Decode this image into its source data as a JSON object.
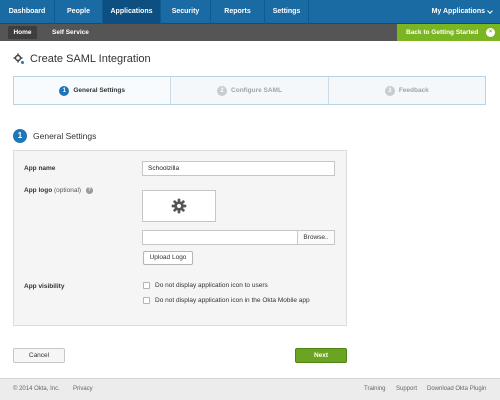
{
  "topnav": {
    "tabs": [
      "Dashboard",
      "People",
      "Applications",
      "Security",
      "Reports",
      "Settings"
    ],
    "active_tab": "Applications",
    "my_apps": "My Applications"
  },
  "subnav": {
    "home": "Home",
    "self_service": "Self Service",
    "get_started": "Back to Getting Started",
    "close": "×"
  },
  "page": {
    "title": "Create SAML Integration",
    "icon": "gear-icon"
  },
  "wizard": {
    "steps": [
      {
        "num": "1",
        "label": "General Settings"
      },
      {
        "num": "2",
        "label": "Configure SAML"
      },
      {
        "num": "3",
        "label": "Feedback"
      }
    ]
  },
  "section": {
    "num": "1",
    "title": "General Settings"
  },
  "form": {
    "app_name_label": "App name",
    "app_name_value": "Schoolzilla",
    "app_logo_label": "App logo",
    "app_logo_optional": "(optional)",
    "help": "?",
    "browse": "Browse..",
    "upload": "Upload Logo",
    "visibility_label": "App visibility",
    "visibility_options": [
      "Do not display application icon to users",
      "Do not display application icon in the Okta Mobile app"
    ]
  },
  "buttons": {
    "cancel": "Cancel",
    "next": "Next"
  },
  "footer": {
    "copyright": "© 2014 Okta, Inc.",
    "privacy": "Privacy",
    "training": "Training",
    "support": "Support",
    "download": "Download Okta Plugin"
  },
  "colors": {
    "nav_blue": "#1a6aa3",
    "accent_green": "#7cb522",
    "step_blue": "#1d76b8"
  }
}
